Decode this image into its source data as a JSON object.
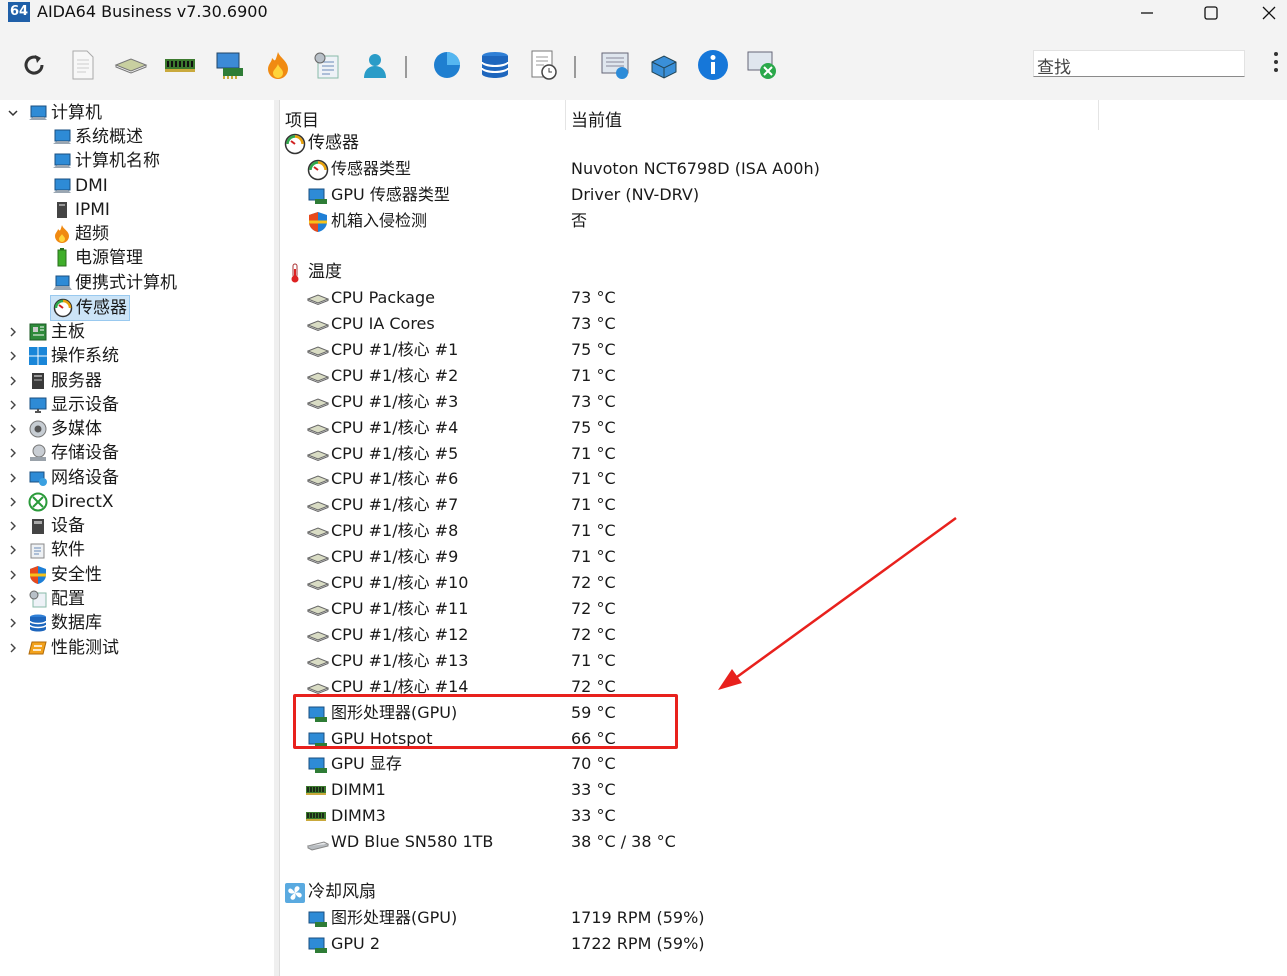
{
  "window": {
    "icon_text": "64",
    "title": "AIDA64 Business v7.30.6900",
    "controls": [
      "minimize",
      "maximize",
      "close"
    ]
  },
  "toolbar": {
    "search_label": "查找",
    "buttons": [
      "refresh-icon",
      "report-icon",
      "motherboard-icon",
      "memory-icon",
      "pci-card-icon",
      "overclock-flame-icon",
      "config-icon",
      "user-icon",
      "disk-benchmark-icon",
      "database-icon",
      "schedule-icon",
      "network-monitor-icon",
      "globe-network-icon",
      "info-icon",
      "remote-icon"
    ]
  },
  "tree": {
    "computer": "计算机",
    "computer_children": [
      "系统概述",
      "计算机名称",
      "DMI",
      "IPMI",
      "超频",
      "电源管理",
      "便携式计算机",
      "传感器"
    ],
    "top_items": [
      "主板",
      "操作系统",
      "服务器",
      "显示设备",
      "多媒体",
      "存储设备",
      "网络设备",
      "DirectX",
      "设备",
      "软件",
      "安全性",
      "配置",
      "数据库",
      "性能测试"
    ]
  },
  "table": {
    "col_item": "项目",
    "col_value": "当前值",
    "groups": [
      {
        "title": "传感器",
        "rows": [
          {
            "name": "传感器类型",
            "value": "Nuvoton NCT6798D  (ISA A00h)"
          },
          {
            "name": "GPU 传感器类型",
            "value": "Driver  (NV-DRV)"
          },
          {
            "name": "机箱入侵检测",
            "value": "否"
          }
        ]
      },
      {
        "title": "温度",
        "rows": [
          {
            "name": "CPU Package",
            "value": "73 °C"
          },
          {
            "name": "CPU IA Cores",
            "value": "73 °C"
          },
          {
            "name": "CPU #1/核心 #1",
            "value": "75 °C"
          },
          {
            "name": "CPU #1/核心 #2",
            "value": "71 °C"
          },
          {
            "name": "CPU #1/核心 #3",
            "value": "73 °C"
          },
          {
            "name": "CPU #1/核心 #4",
            "value": "75 °C"
          },
          {
            "name": "CPU #1/核心 #5",
            "value": "71 °C"
          },
          {
            "name": "CPU #1/核心 #6",
            "value": "71 °C"
          },
          {
            "name": "CPU #1/核心 #7",
            "value": "71 °C"
          },
          {
            "name": "CPU #1/核心 #8",
            "value": "71 °C"
          },
          {
            "name": "CPU #1/核心 #9",
            "value": "71 °C"
          },
          {
            "name": "CPU #1/核心 #10",
            "value": "72 °C"
          },
          {
            "name": "CPU #1/核心 #11",
            "value": "72 °C"
          },
          {
            "name": "CPU #1/核心 #12",
            "value": "72 °C"
          },
          {
            "name": "CPU #1/核心 #13",
            "value": "71 °C"
          },
          {
            "name": "CPU #1/核心 #14",
            "value": "72 °C"
          },
          {
            "name": "图形处理器(GPU)",
            "value": "59 °C"
          },
          {
            "name": "GPU Hotspot",
            "value": "66 °C"
          },
          {
            "name": "GPU 显存",
            "value": "70 °C"
          },
          {
            "name": "DIMM1",
            "value": "33 °C"
          },
          {
            "name": "DIMM3",
            "value": "33 °C"
          },
          {
            "name": "WD Blue SN580 1TB",
            "value": "38 °C / 38 °C"
          }
        ]
      },
      {
        "title": "冷却风扇",
        "rows": [
          {
            "name": "图形处理器(GPU)",
            "value": "1719 RPM  (59%)"
          },
          {
            "name": "GPU 2",
            "value": "1722 RPM  (59%)"
          }
        ]
      }
    ]
  },
  "annotation": {
    "color": "#e8211d"
  }
}
